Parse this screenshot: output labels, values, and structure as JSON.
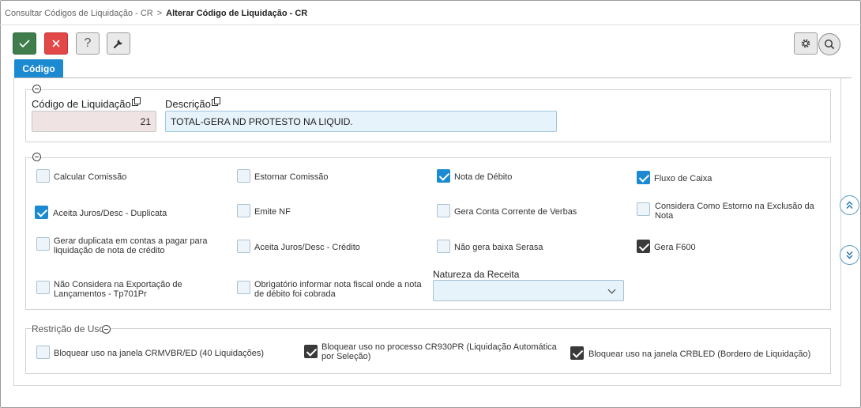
{
  "breadcrumb": {
    "parent": "Consultar Códigos de Liquidação - CR",
    "separator": ">",
    "current": "Alterar Código de Liquidação - CR"
  },
  "toolbar": {
    "save_icon": "check-icon",
    "cancel_icon": "close-icon",
    "help_label": "?",
    "tools_icon": "wrench-icon",
    "settings_icon": "gear-icon",
    "search_icon": "search-icon"
  },
  "tabs": [
    {
      "label": "Código",
      "active": true
    }
  ],
  "fields": {
    "codigo_label": "Código de Liquidação",
    "codigo_value": "21",
    "descricao_label": "Descrição",
    "descricao_value": "TOTAL-GERA ND PROTESTO NA LIQUID."
  },
  "options": [
    {
      "label": "Calcular Comissão",
      "checked": false
    },
    {
      "label": "Estornar Comissão",
      "checked": false
    },
    {
      "label": "Nota de Débito",
      "checked": true
    },
    {
      "label": "Fluxo de Caixa",
      "checked": true
    },
    {
      "label": "Aceita Juros/Desc - Duplicata",
      "checked": true
    },
    {
      "label": "Emite NF",
      "checked": false
    },
    {
      "label": "Gera Conta Corrente de Verbas",
      "checked": false
    },
    {
      "label": "Considera Como Estorno na Exclusão da Nota",
      "checked": false
    },
    {
      "label": "Gerar duplicata em contas a pagar para liquidação de nota de crédito",
      "checked": false
    },
    {
      "label": "Aceita Juros/Desc - Crédito",
      "checked": false
    },
    {
      "label": "Não gera baixa Serasa",
      "checked": false
    },
    {
      "label": "Gera F600",
      "checked": true
    },
    {
      "label": "Não Considera na Exportação de Lançamentos - Tp701Pr",
      "checked": false
    },
    {
      "label": "Obrigatório informar nota fiscal onde a nota de débito foi cobrada",
      "checked": false
    }
  ],
  "natureza": {
    "label": "Natureza da Receita",
    "value": ""
  },
  "restricao": {
    "title": "Restrição de Uso",
    "items": [
      {
        "label": "Bloquear uso na janela CRMVBR/ED (40 Liquidações)",
        "checked": false
      },
      {
        "label": "Bloquear uso no processo CR930PR (Liquidação Automática por Seleção)",
        "checked": true
      },
      {
        "label": "Bloquear uso na janela CRBLED (Bordero de Liquidação)",
        "checked": true
      }
    ]
  },
  "side_nav": {
    "up_icon": "double-chevron-up-icon",
    "down_icon": "double-chevron-down-icon"
  },
  "colors": {
    "accent": "#1b8ad1",
    "save": "#3f7d4c",
    "cancel": "#e34848"
  }
}
